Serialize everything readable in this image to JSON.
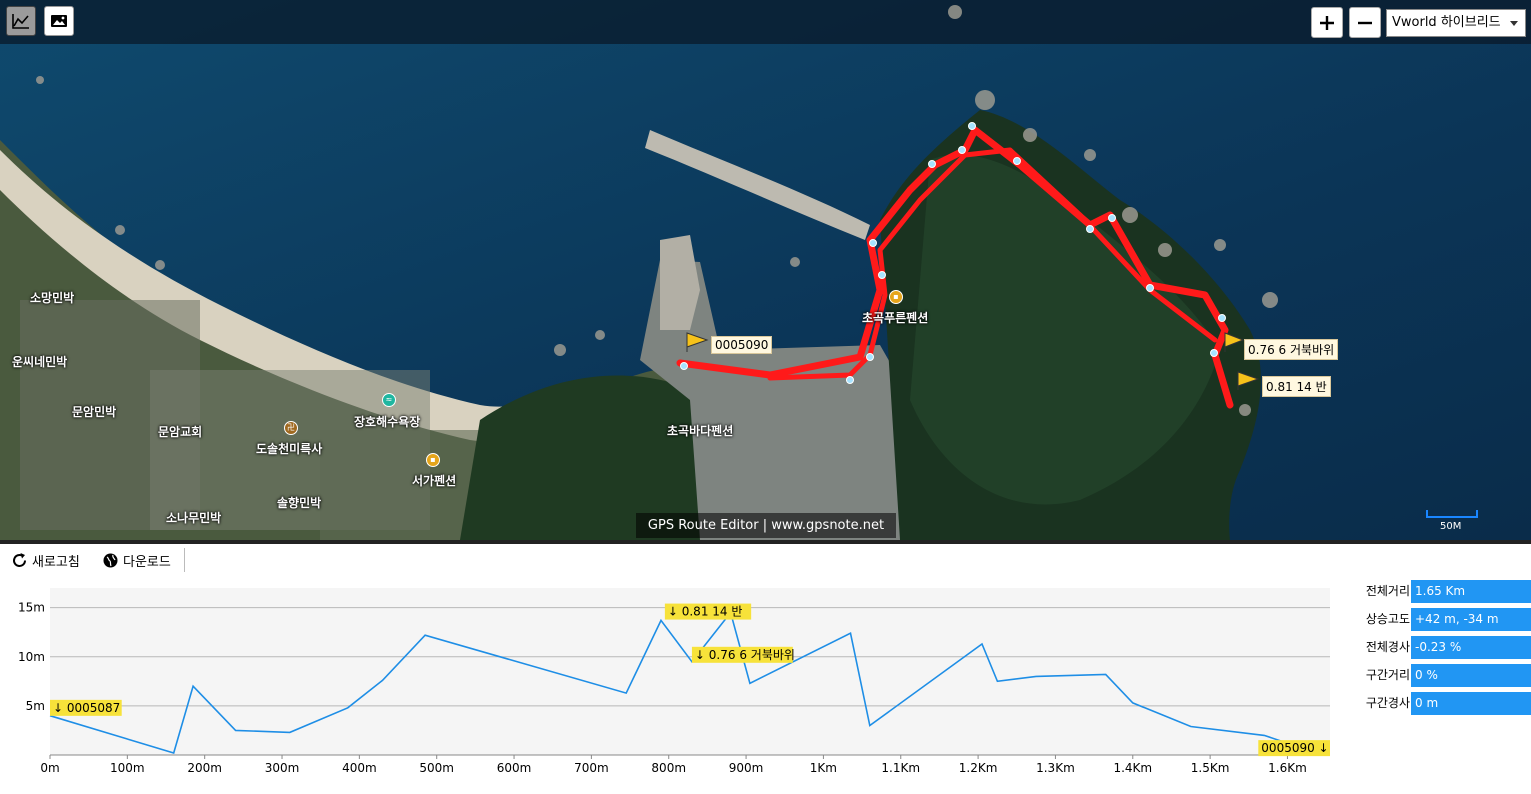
{
  "map": {
    "layer": "Vworld 하이브리드",
    "labels": [
      {
        "text": "소망민박"
      },
      {
        "text": "운씨네민박"
      },
      {
        "text": "문암민박"
      },
      {
        "text": "문암교회"
      },
      {
        "text": "도솔천미륵사"
      },
      {
        "text": "장호해수욕장"
      },
      {
        "text": "서가펜션"
      },
      {
        "text": "솔향민박"
      },
      {
        "text": "소나무민박"
      },
      {
        "text": "초곡바다펜션"
      },
      {
        "text": "초곡푸른펜션"
      }
    ],
    "waypoints": [
      {
        "label": "0005090"
      },
      {
        "label": "0.76 6 거북바위"
      },
      {
        "label": "0.81 14 반"
      }
    ],
    "hidden_label": "0005087",
    "attribution": "GPS Route Editor | www.gpsnote.net",
    "scale": "50M",
    "route_color": "#ff1a1a"
  },
  "toolbar": {
    "refresh": "새로고침",
    "download": "다운로드"
  },
  "chart_data": {
    "type": "line",
    "x": [
      0,
      160,
      185,
      240,
      310,
      385,
      430,
      485,
      745,
      790,
      830,
      880,
      905,
      1035,
      1060,
      1205,
      1225,
      1275,
      1365,
      1400,
      1475,
      1570,
      1600
    ],
    "y": [
      4,
      0.2,
      7,
      2.5,
      2.3,
      4.8,
      7.6,
      12.2,
      6.3,
      13.7,
      9.5,
      14.5,
      7.3,
      12.4,
      3,
      11.3,
      7.5,
      8,
      8.2,
      5.3,
      2.9,
      2,
      1.2
    ],
    "xlim": [
      0,
      1655
    ],
    "ylim": [
      0,
      17
    ],
    "x_ticks": [
      {
        "v": 0,
        "label": "0m"
      },
      {
        "v": 100,
        "label": "100m"
      },
      {
        "v": 200,
        "label": "200m"
      },
      {
        "v": 300,
        "label": "300m"
      },
      {
        "v": 400,
        "label": "400m"
      },
      {
        "v": 500,
        "label": "500m"
      },
      {
        "v": 600,
        "label": "600m"
      },
      {
        "v": 700,
        "label": "700m"
      },
      {
        "v": 800,
        "label": "800m"
      },
      {
        "v": 900,
        "label": "900m"
      },
      {
        "v": 1000,
        "label": "1Km"
      },
      {
        "v": 1100,
        "label": "1.1Km"
      },
      {
        "v": 1200,
        "label": "1.2Km"
      },
      {
        "v": 1300,
        "label": "1.3Km"
      },
      {
        "v": 1400,
        "label": "1.4Km"
      },
      {
        "v": 1500,
        "label": "1.5Km"
      },
      {
        "v": 1600,
        "label": "1.6Km"
      }
    ],
    "y_ticks": [
      {
        "v": 5,
        "label": "5m"
      },
      {
        "v": 10,
        "label": "10m"
      },
      {
        "v": 15,
        "label": "15m"
      }
    ],
    "annotations": [
      {
        "x": 0,
        "y": 4.8,
        "text": "↓ 0005087",
        "anchor": "start"
      },
      {
        "x": 795,
        "y": 14.6,
        "text": "↓ 0.81 14 반",
        "anchor": "start"
      },
      {
        "x": 830,
        "y": 10.2,
        "text": "↓ 0.76 6 거북바위",
        "anchor": "start"
      },
      {
        "x": 1655,
        "y": 0.7,
        "text": "0005090 ↓",
        "anchor": "end"
      }
    ],
    "grid": true,
    "line_color": "#1e8ee6"
  },
  "stats": [
    {
      "label": "전체거리",
      "value": "1.65 Km"
    },
    {
      "label": "상승고도",
      "value": "+42 m, -34 m"
    },
    {
      "label": "전체경사",
      "value": "-0.23 %"
    },
    {
      "label": "구간거리",
      "value": "0 %"
    },
    {
      "label": "구간경사",
      "value": "0 m"
    }
  ]
}
